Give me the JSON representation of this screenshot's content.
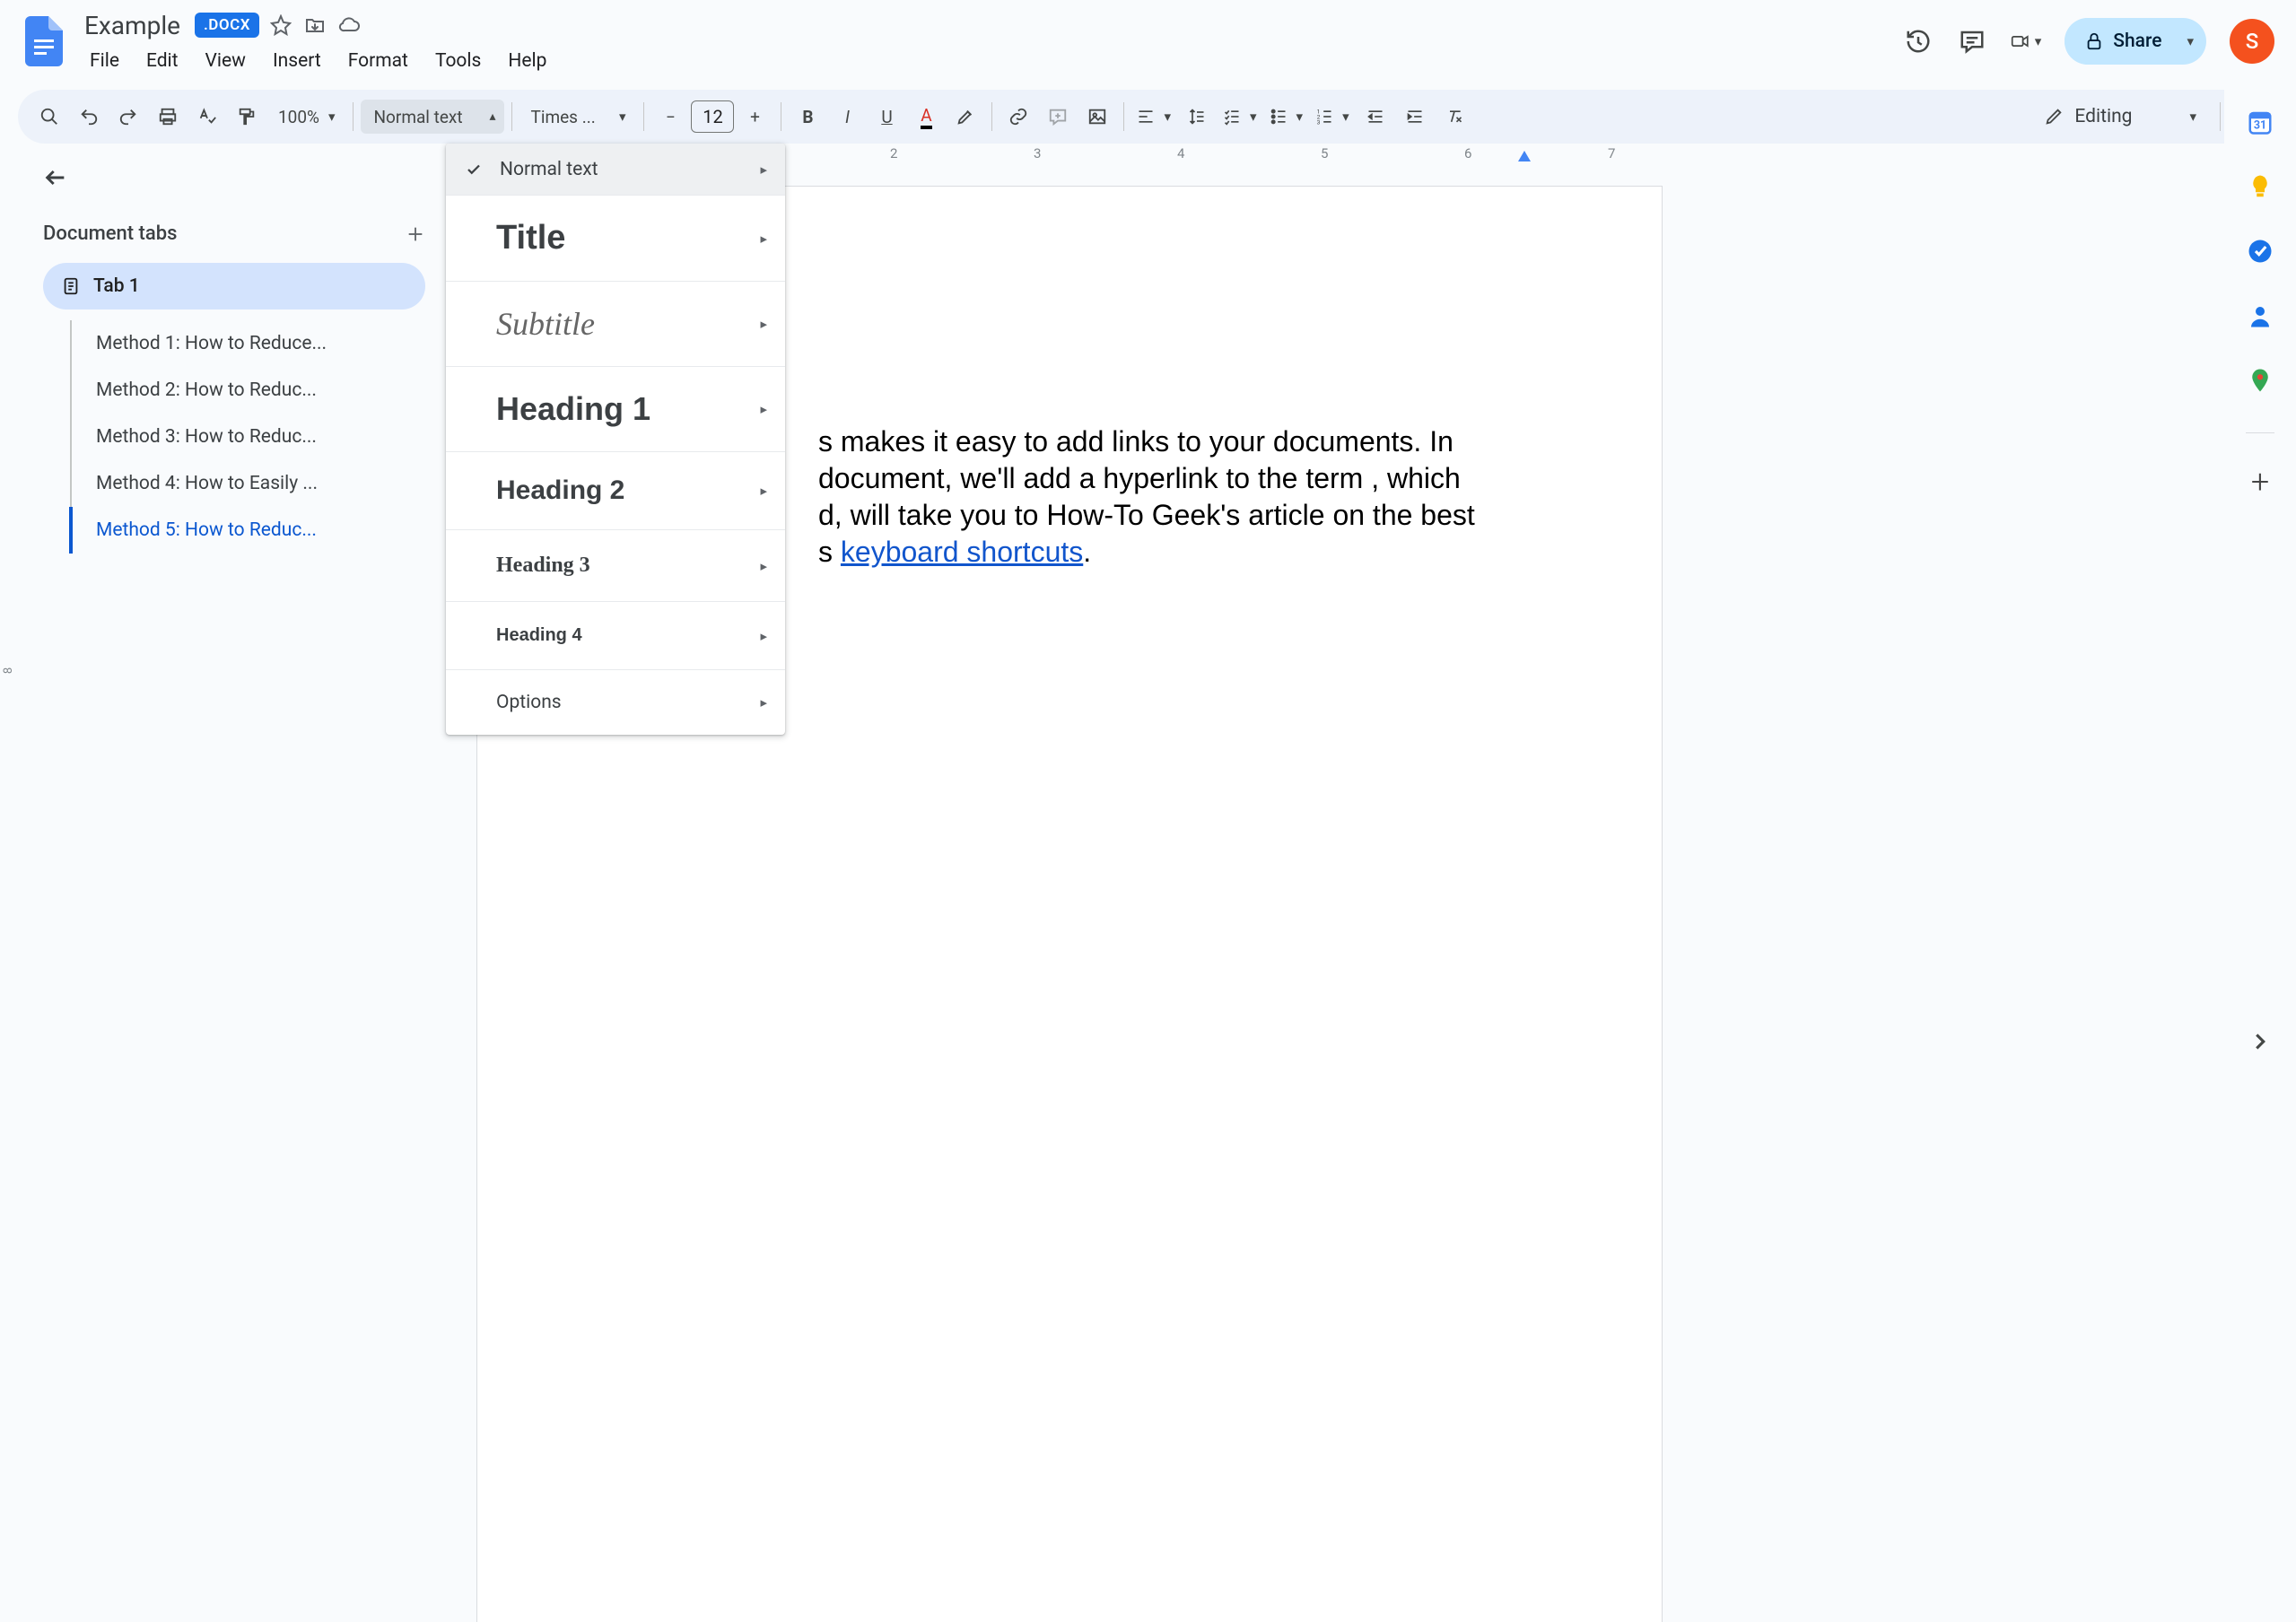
{
  "header": {
    "doc_title": "Example",
    "badge": ".DOCX",
    "menu": [
      "File",
      "Edit",
      "View",
      "Insert",
      "Format",
      "Tools",
      "Help"
    ],
    "share_label": "Share",
    "avatar_letter": "S"
  },
  "toolbar": {
    "zoom": "100%",
    "style": "Normal text",
    "font": "Times ...",
    "font_size": "12",
    "mode": "Editing"
  },
  "styles_popup": {
    "items": [
      {
        "key": "normal",
        "label": "Normal text",
        "checked": true
      },
      {
        "key": "title",
        "label": "Title"
      },
      {
        "key": "subtitle",
        "label": "Subtitle"
      },
      {
        "key": "h1",
        "label": "Heading 1"
      },
      {
        "key": "h2",
        "label": "Heading 2"
      },
      {
        "key": "h3",
        "label": "Heading 3"
      },
      {
        "key": "h4",
        "label": "Heading 4"
      },
      {
        "key": "options",
        "label": "Options"
      }
    ]
  },
  "sidebar": {
    "title": "Document tabs",
    "tab_label": "Tab 1",
    "outline": [
      {
        "label": "Method 1: How to Reduce...",
        "active": false
      },
      {
        "label": "Method 2: How to Reduc...",
        "active": false
      },
      {
        "label": "Method 3: How to Reduc...",
        "active": false
      },
      {
        "label": "Method 4: How to Easily ...",
        "active": false
      },
      {
        "label": "Method 5: How to Reduc...",
        "active": true
      }
    ]
  },
  "ruler": {
    "numbers": [
      "2",
      "3",
      "4",
      "5",
      "6",
      "7"
    ],
    "v_numbers": [
      "8"
    ]
  },
  "document": {
    "line1": "s makes it easy to add links to your documents. In",
    "line2": "document, we'll add a hyperlink to the term , which",
    "line3": "d, will take you to How-To Geek's article on the best",
    "line4_pre": "s ",
    "line4_link": "keyboard shortcuts",
    "line4_post": "."
  }
}
